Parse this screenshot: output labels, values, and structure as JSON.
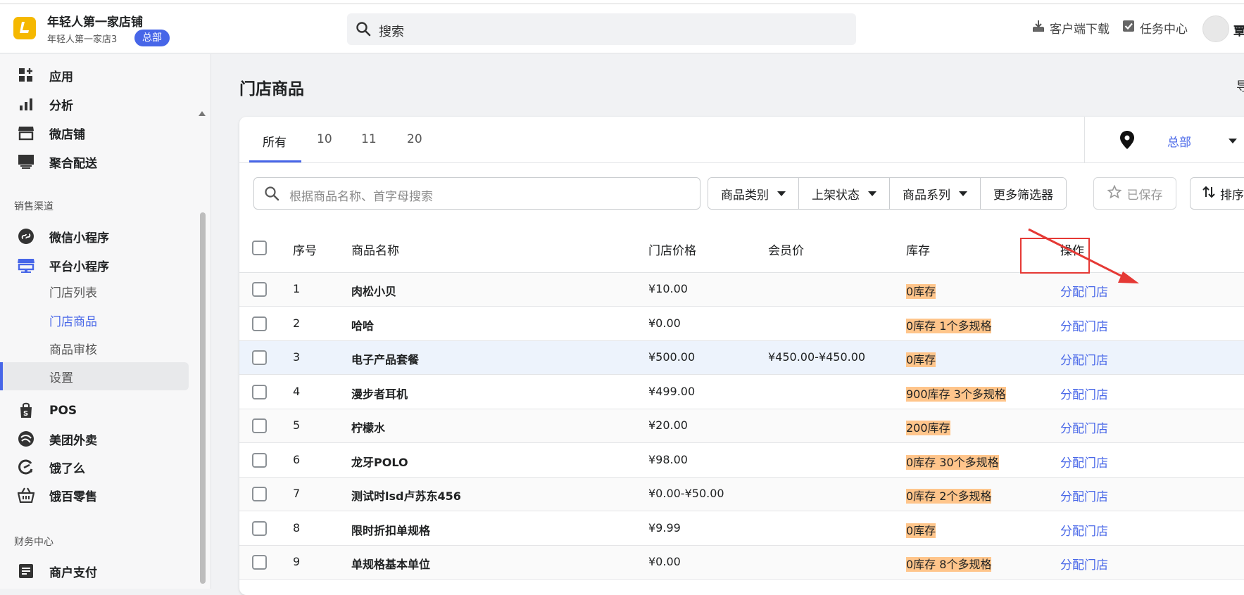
{
  "topbar": {
    "store_name": "年轻人第一家店铺",
    "store_sub": "年轻人第一家店3",
    "hq_badge": "总部",
    "search_text": "搜索",
    "client_download": "客户端下载",
    "task_center": "任务中心",
    "user_initial": "覃"
  },
  "sidebar": {
    "items_top": [
      {
        "label": "应用",
        "icon": "apps-icon"
      },
      {
        "label": "分析",
        "icon": "bar-chart-icon"
      },
      {
        "label": "微店铺",
        "icon": "store-icon"
      },
      {
        "label": "聚合配送",
        "icon": "monitor-icon"
      }
    ],
    "sales_section": "销售渠道",
    "channels": [
      {
        "label": "微信小程序",
        "icon": "miniprogram-icon"
      },
      {
        "label": "平台小程序",
        "icon": "platform-store-icon"
      }
    ],
    "sub_items": [
      "门店列表",
      "门店商品",
      "商品审核",
      "设置"
    ],
    "active_sub": "门店商品",
    "channels_more": [
      {
        "label": "POS",
        "icon": "pos-bag-icon"
      },
      {
        "label": "美团外卖",
        "icon": "meituan-icon"
      },
      {
        "label": "饿了么",
        "icon": "eleme-icon"
      },
      {
        "label": "饿百零售",
        "icon": "basket-icon"
      }
    ],
    "finance_section": "财务中心",
    "finance_items": [
      {
        "label": "商户支付",
        "icon": "document-icon"
      }
    ]
  },
  "main": {
    "page_title": "门店商品",
    "page_title_right": "导",
    "tabs": [
      "所有",
      "10",
      "11",
      "20"
    ],
    "active_tab": "所有",
    "location_label": "总部",
    "filter_search_placeholder": "根据商品名称、首字母搜索",
    "filters": [
      "商品类别",
      "上架状态",
      "商品系列",
      "更多筛选器"
    ],
    "saved_label": "已保存",
    "sort_label": "排序"
  },
  "table": {
    "headers": {
      "index": "序号",
      "name": "商品名称",
      "store_price": "门店价格",
      "member_price": "会员价",
      "stock": "库存",
      "action": "操作"
    },
    "rows": [
      {
        "index": "1",
        "name": "肉松小贝",
        "store_price": "¥10.00",
        "member_price": "",
        "stock": "0库存",
        "action": "分配门店"
      },
      {
        "index": "2",
        "name": "哈哈",
        "store_price": "¥0.00",
        "member_price": "",
        "stock": "0库存 1个多规格",
        "action": "分配门店"
      },
      {
        "index": "3",
        "name": "电子产品套餐",
        "store_price": "¥500.00",
        "member_price": "¥450.00-¥450.00",
        "stock": "0库存",
        "action": "分配门店"
      },
      {
        "index": "4",
        "name": "漫步者耳机",
        "store_price": "¥499.00",
        "member_price": "",
        "stock": "900库存 3个多规格",
        "action": "分配门店"
      },
      {
        "index": "5",
        "name": "柠檬水",
        "store_price": "¥20.00",
        "member_price": "",
        "stock": "200库存",
        "action": "分配门店"
      },
      {
        "index": "6",
        "name": "龙牙POLO",
        "store_price": "¥98.00",
        "member_price": "",
        "stock": "0库存 30个多规格",
        "action": "分配门店"
      },
      {
        "index": "7",
        "name": "测试时lsd卢苏东456",
        "store_price": "¥0.00-¥50.00",
        "member_price": "",
        "stock": "0库存 2个多规格",
        "action": "分配门店"
      },
      {
        "index": "8",
        "name": "限时折扣单规格",
        "store_price": "¥9.99",
        "member_price": "",
        "stock": "0库存",
        "action": "分配门店"
      },
      {
        "index": "9",
        "name": "单规格基本单位",
        "store_price": "¥0.00",
        "member_price": "",
        "stock": "0库存 8个多规格",
        "action": "分配门店"
      }
    ]
  },
  "colors": {
    "accent": "#4766e8",
    "stock_highlight": "#ffc58b",
    "annotation_red": "#e53935",
    "logo_yellow": "#f5b800"
  }
}
